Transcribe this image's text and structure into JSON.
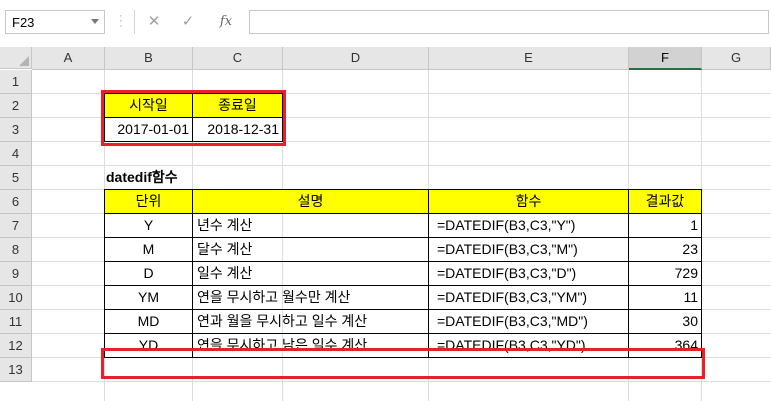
{
  "namebox": {
    "value": "F23"
  },
  "formula_bar": {
    "cancel_icon": "✕",
    "enter_icon": "✓",
    "fx_label": "fx",
    "content": ""
  },
  "columns": [
    "A",
    "B",
    "C",
    "D",
    "E",
    "F",
    "G"
  ],
  "rows": [
    "1",
    "2",
    "3",
    "4",
    "5",
    "6",
    "7",
    "8",
    "9",
    "10",
    "11",
    "12",
    "13"
  ],
  "date_table": {
    "header_start": "시작일",
    "header_end": "종료일",
    "start_value": "2017-01-01",
    "end_value": "2018-12-31"
  },
  "section_title": "datedif함수",
  "func_table": {
    "headers": [
      "단위",
      "설명",
      "함수",
      "결과값"
    ],
    "rows": [
      {
        "unit": "Y",
        "desc": "년수 계산",
        "func": "=DATEDIF(B3,C3,\"Y\")",
        "result": "1"
      },
      {
        "unit": "M",
        "desc": "달수 계산",
        "func": "=DATEDIF(B3,C3,\"M\")",
        "result": "23"
      },
      {
        "unit": "D",
        "desc": "일수 계산",
        "func": "=DATEDIF(B3,C3,\"D\")",
        "result": "729"
      },
      {
        "unit": "YM",
        "desc": "연을 무시하고 월수만 계산",
        "func": "=DATEDIF(B3,C3,\"YM\")",
        "result": "11"
      },
      {
        "unit": "MD",
        "desc": "연과 월을 무시하고 일수 계산",
        "func": "=DATEDIF(B3,C3,\"MD\")",
        "result": "30"
      },
      {
        "unit": "YD",
        "desc": "연을 무시하고 남은 일수 계산",
        "func": "=DATEDIF(B3,C3,\"YD\")",
        "result": "364"
      }
    ]
  },
  "colors": {
    "highlight_fill": "#ffff00",
    "annotation_box": "#e8202a",
    "selected_header_accent": "#217346"
  }
}
